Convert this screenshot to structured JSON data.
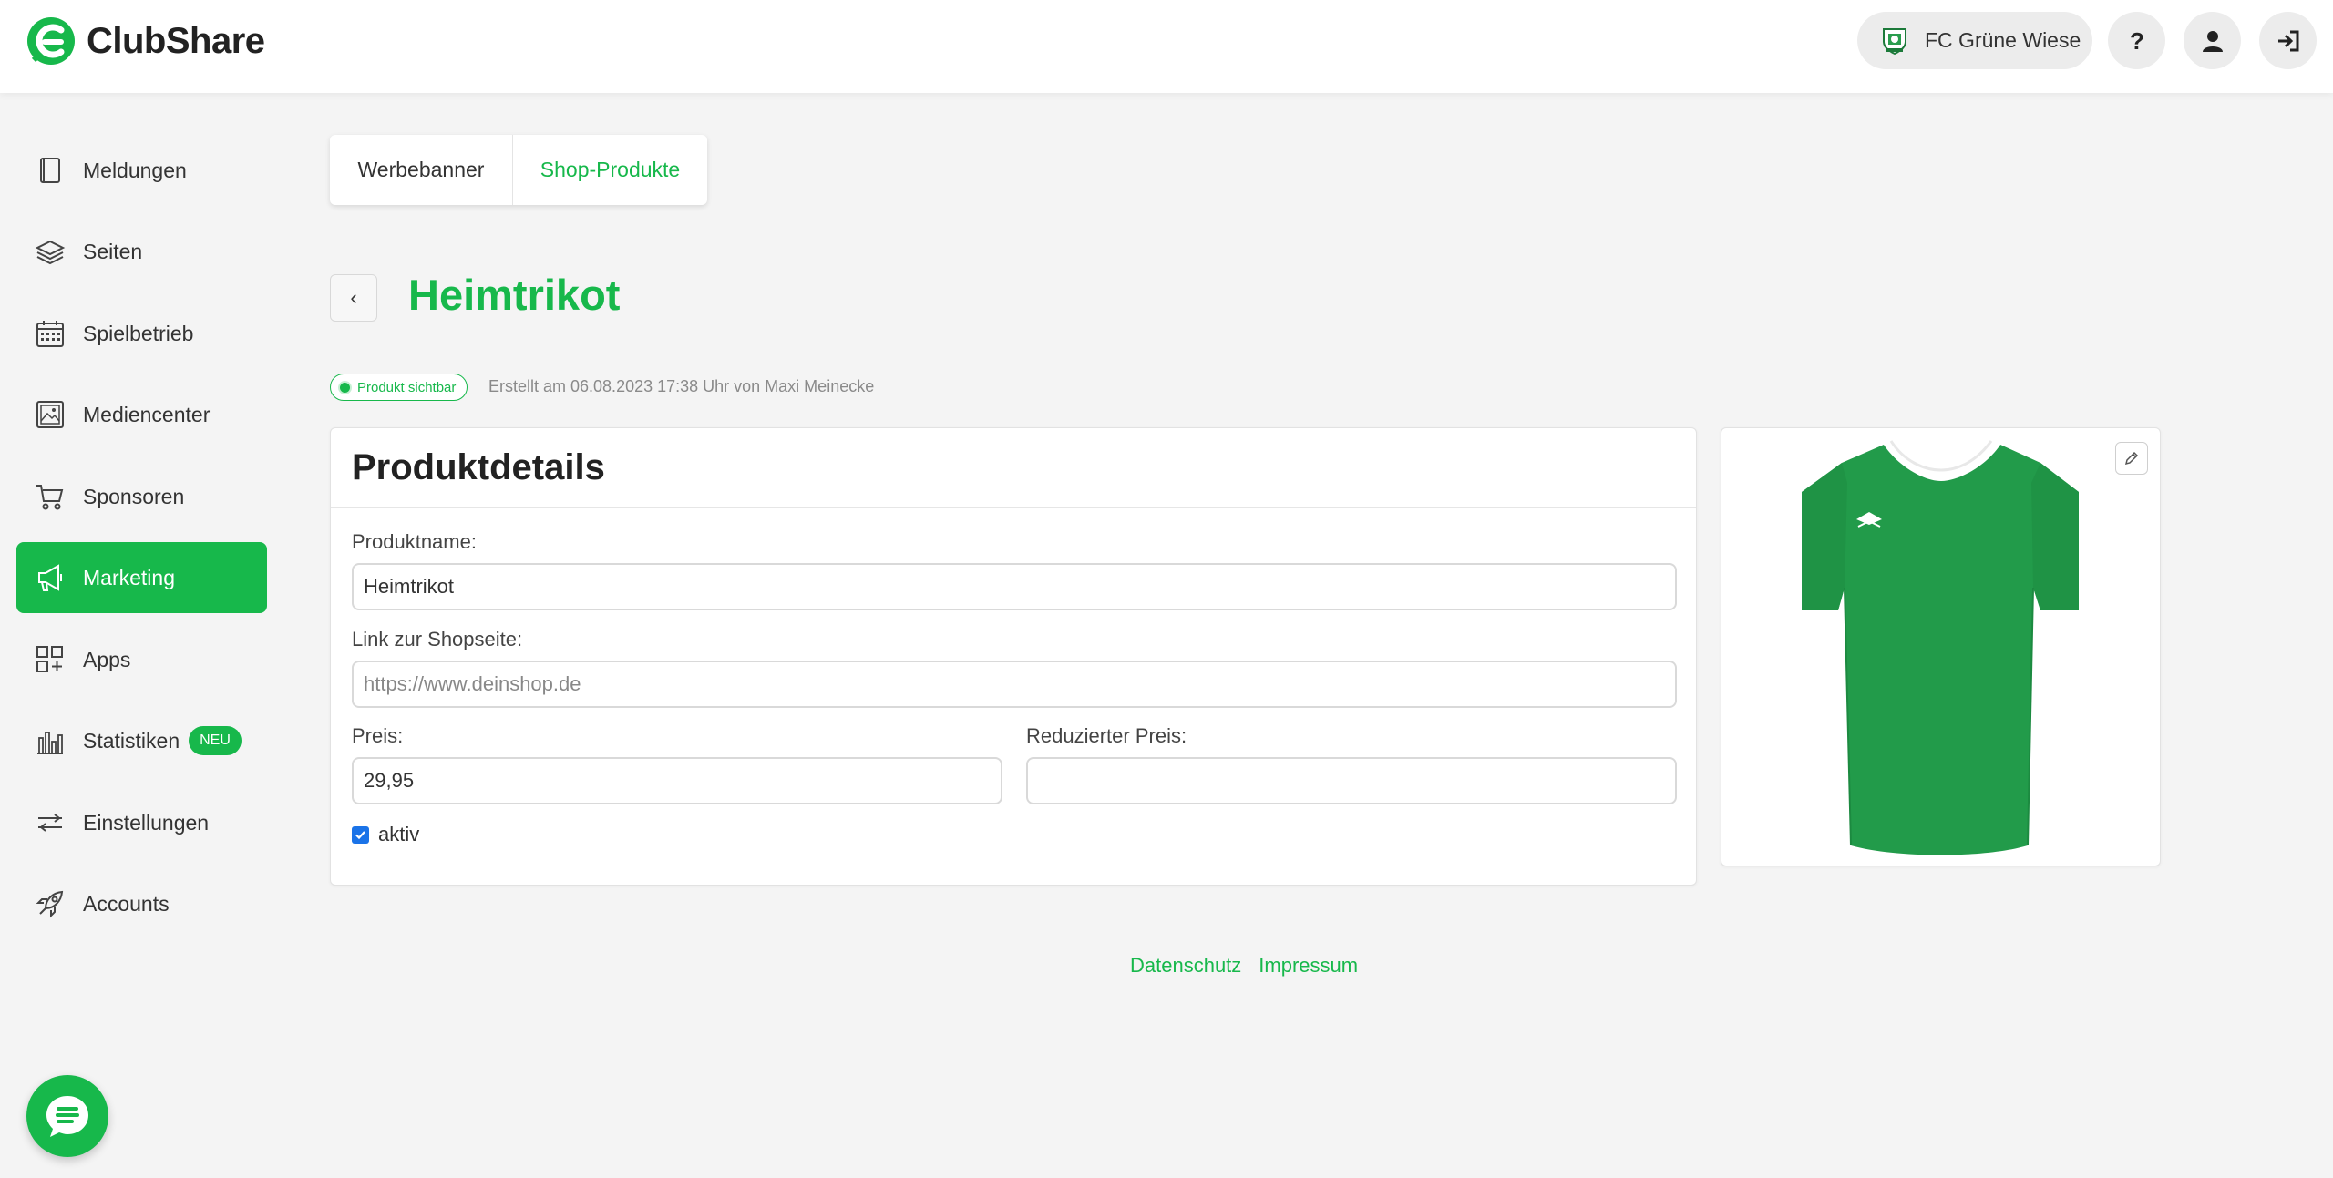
{
  "app": {
    "name": "ClubShare",
    "brand_color": "#17b84b"
  },
  "header": {
    "club_name": "FC Grüne Wiese",
    "help_icon": "question-icon",
    "profile_icon": "user-icon",
    "logout_icon": "logout-icon"
  },
  "sidebar": {
    "items": [
      {
        "label": "Meldungen",
        "icon": "book-icon",
        "active": false
      },
      {
        "label": "Seiten",
        "icon": "layers-icon",
        "active": false
      },
      {
        "label": "Spielbetrieb",
        "icon": "calendar-icon",
        "active": false
      },
      {
        "label": "Mediencenter",
        "icon": "image-icon",
        "active": false
      },
      {
        "label": "Sponsoren",
        "icon": "cart-icon",
        "active": false
      },
      {
        "label": "Marketing",
        "icon": "megaphone-icon",
        "active": true
      },
      {
        "label": "Apps",
        "icon": "apps-icon",
        "active": false
      },
      {
        "label": "Statistiken",
        "icon": "bar-chart-icon",
        "active": false,
        "badge": "NEU"
      },
      {
        "label": "Einstellungen",
        "icon": "sliders-icon",
        "active": false
      },
      {
        "label": "Accounts",
        "icon": "rocket-icon",
        "active": false
      }
    ]
  },
  "tabs": [
    {
      "label": "Werbebanner",
      "active": false
    },
    {
      "label": "Shop-Produkte",
      "active": true
    }
  ],
  "page": {
    "title": "Heimtrikot",
    "back_label": "‹",
    "status": "Produkt sichtbar",
    "meta": "Erstellt am 06.08.2023 17:38 Uhr von Maxi Meinecke"
  },
  "form": {
    "section_title": "Produktdetails",
    "name_label": "Produktname:",
    "name_value": "Heimtrikot",
    "link_label": "Link zur Shopseite:",
    "link_placeholder": "https://www.deinshop.de",
    "price_label": "Preis:",
    "price_value": "29,95",
    "reduced_label": "Reduzierter Preis:",
    "reduced_value": "",
    "active_label": "aktiv",
    "active_checked": true
  },
  "product_image": {
    "subject": "green jersey",
    "edit_icon": "pencil-icon"
  },
  "footer": {
    "links": [
      "Datenschutz",
      "Impressum"
    ]
  },
  "chat": {
    "icon": "chat-icon"
  }
}
